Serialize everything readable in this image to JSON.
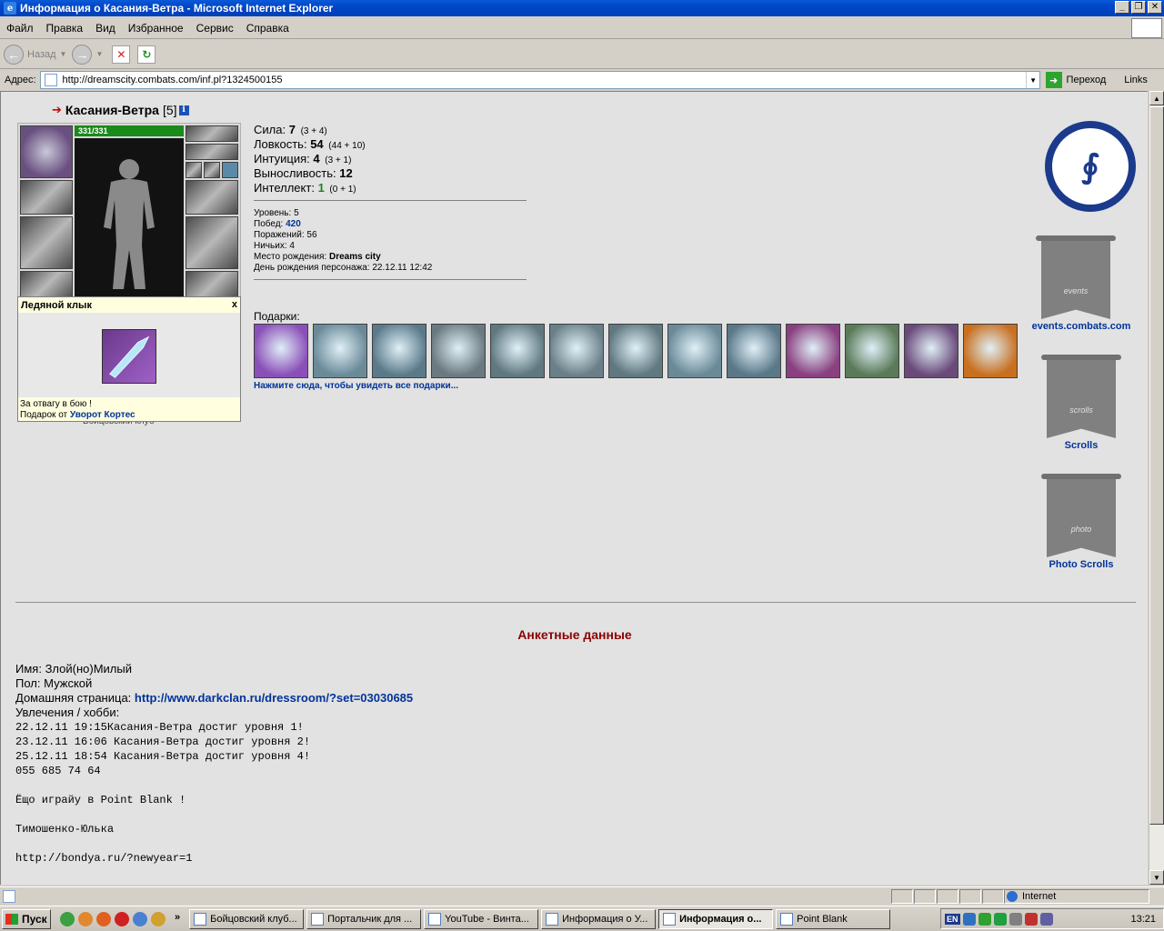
{
  "window": {
    "title": "Информация о Касания-Ветра - Microsoft Internet Explorer",
    "icon": "ie-icon",
    "buttons": [
      "_",
      "❐",
      "✕"
    ]
  },
  "menu": [
    "Файл",
    "Правка",
    "Вид",
    "Избранное",
    "Сервис",
    "Справка"
  ],
  "toolbar": {
    "back_label": "Назад"
  },
  "address": {
    "label": "Адрес:",
    "url": "http://dreamscity.combats.com/inf.pl?1324500155",
    "go_label": "Переход",
    "links_label": "Links"
  },
  "character": {
    "name": "Касания-Ветра",
    "level": "[5]",
    "hp": "331/331"
  },
  "popup": {
    "title": "Ледяной клык",
    "close": "x",
    "line1": "За отвагу в бою !",
    "from_prefix": "Подарок от",
    "from_name": "Уворот Кортес",
    "underlying_text": "Бойцовский клуб"
  },
  "stats": [
    {
      "label": "Сила:",
      "value": "7",
      "sub": "(3 + 4)",
      "green": false
    },
    {
      "label": "Ловкость:",
      "value": "54",
      "sub": "(44 + 10)",
      "green": false
    },
    {
      "label": "Интуиция:",
      "value": "4",
      "sub": "(3 + 1)",
      "green": false
    },
    {
      "label": "Выносливость:",
      "value": "12",
      "sub": "",
      "green": false
    },
    {
      "label": "Интеллект:",
      "value": "1",
      "sub": "(0 + 1)",
      "green": true
    }
  ],
  "info": {
    "level_label": "Уровень:",
    "level": "5",
    "wins_label": "Побед:",
    "wins": "420",
    "losses_label": "Поражений:",
    "losses": "56",
    "draws_label": "Ничьих:",
    "draws": "4",
    "birthplace_label": "Место рождения:",
    "birthplace": "Dreams city",
    "birthday_label": "День рождения персонажа:",
    "birthday": "22.12.11 12:42"
  },
  "gifts": {
    "title": "Подарки:",
    "link": "Нажмите сюда, чтобы увидеть все подарки...",
    "items": [
      {
        "icon": "ice-fang-icon",
        "color": "#8a4fb8"
      },
      {
        "icon": "snow-house-icon",
        "color": "#6a8a98"
      },
      {
        "icon": "santa-smiley-icon",
        "color": "#5a7a8a"
      },
      {
        "icon": "snowflake-icon",
        "color": "#6a7a80"
      },
      {
        "icon": "candy-cane-icon",
        "color": "#607880"
      },
      {
        "icon": "gingerbread-man-icon",
        "color": "#6a8088"
      },
      {
        "icon": "candy-cane-icon",
        "color": "#607880"
      },
      {
        "icon": "year-2012-icon",
        "color": "#6a8a98"
      },
      {
        "icon": "ice-tree-icon",
        "color": "#5a7888"
      },
      {
        "icon": "fire-staff-icon",
        "color": "#8a4080"
      },
      {
        "icon": "goblin-icon",
        "color": "#5a7a58"
      },
      {
        "icon": "dragon-icon",
        "color": "#6a4a7a"
      },
      {
        "icon": "winter-card-icon",
        "color": "#c87020"
      }
    ]
  },
  "sidebar": {
    "banners": [
      {
        "label": "events",
        "caption": "events.combats.com"
      },
      {
        "label": "scrolls",
        "caption": "Scrolls"
      },
      {
        "label": "photo",
        "caption": "Photo Scrolls"
      }
    ]
  },
  "anketa": {
    "title": "Анкетные данные",
    "name_label": "Имя:",
    "name": "Злой(но)Милый",
    "gender_label": "Пол:",
    "gender": "Мужской",
    "homepage_label": "Домашняя страница:",
    "homepage": "http://www.darkclan.ru/dressroom/?set=03030685",
    "hobbies_label": "Увлечения / хобби:",
    "lines": [
      "22.12.11 19:15Касания-Ветра достиг уровня 1!",
      "23.12.11 16:06 Касания-Ветра достиг уровня 2!",
      "25.12.11 18:54 Касания-Ветра достиг уровня 4!",
      "055 685 74 64",
      "",
      "Ёщо играйу в Point Blank !",
      "",
      "Тимошенко-Юлька",
      "",
      "http://bondya.ru/?newyear=1"
    ]
  },
  "status": {
    "zone": "Internet"
  },
  "taskbar": {
    "start": "Пуск",
    "more": "»",
    "tasks": [
      {
        "label": "Бойцовский клуб...",
        "active": false
      },
      {
        "label": "Портальчик для ...",
        "active": false
      },
      {
        "label": "YouTube - Винта...",
        "active": false
      },
      {
        "label": "Информация о У...",
        "active": false
      },
      {
        "label": "Информация о...",
        "active": true
      },
      {
        "label": "Point Blank",
        "active": false
      }
    ],
    "lang": "EN",
    "clock": "13:21"
  }
}
